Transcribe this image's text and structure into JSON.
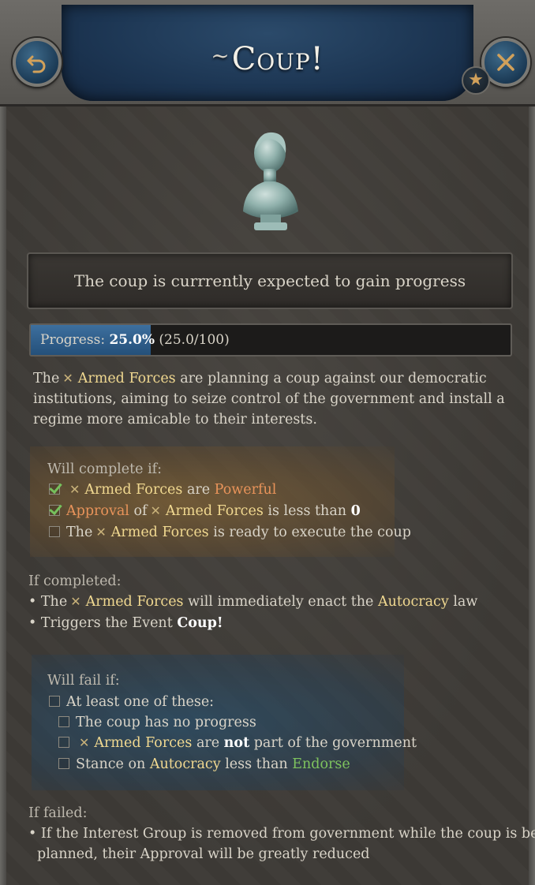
{
  "header": {
    "title": "Coup!",
    "flourish": "~",
    "back_icon": "undo-arrow-icon",
    "close_icon": "close-x-icon",
    "favorite_icon": "star-icon"
  },
  "status": {
    "text": "The coup is currrently expected to gain progress"
  },
  "progress": {
    "label": "Progress:",
    "percent_text": "25.0%",
    "value_text": "(25.0/100)",
    "fraction": 0.25
  },
  "description": {
    "prefix": "The",
    "group": "Armed Forces",
    "suffix": "are planning a coup against our democratic institutions, aiming to seize control of the government and install a regime more amicable to their interests."
  },
  "complete_if": {
    "heading": "Will complete if:",
    "items": [
      {
        "checked": true,
        "parts": [
          "",
          "Armed Forces",
          "are",
          "Powerful"
        ]
      },
      {
        "checked": true,
        "parts": [
          "Approval",
          "of",
          "Armed Forces",
          "is less than",
          "0"
        ]
      },
      {
        "checked": false,
        "parts": [
          "The",
          "Armed Forces",
          "is ready to execute the coup"
        ]
      }
    ]
  },
  "if_completed": {
    "heading": "If completed:",
    "line1": {
      "prefix": "• The",
      "group": "Armed Forces",
      "mid": "will immediately enact the",
      "law": "Autocracy",
      "suffix": "law"
    },
    "line2": {
      "prefix": "• Triggers the Event",
      "event": "Coup!"
    }
  },
  "fail_if": {
    "heading": "Will fail if:",
    "group_label": "At least one of these:",
    "items": [
      {
        "text": "The coup has no progress"
      },
      {
        "group": "Armed Forces",
        "are": "are",
        "not": "not",
        "rest": "part of the government"
      },
      {
        "prefix": "Stance on",
        "law": "Autocracy",
        "mid": "less than",
        "stance": "Endorse"
      }
    ]
  },
  "if_failed": {
    "heading": "If failed:",
    "line1": "• If the Interest Group is removed from government while the coup is being",
    "line2": "planned, their Approval will be greatly reduced"
  },
  "colors": {
    "interest_group": "#f0d890",
    "negative": "#e8935a",
    "positive": "#7ec35e",
    "progress_fill": "#3d6f9e",
    "header_blue": "#1c3552"
  }
}
